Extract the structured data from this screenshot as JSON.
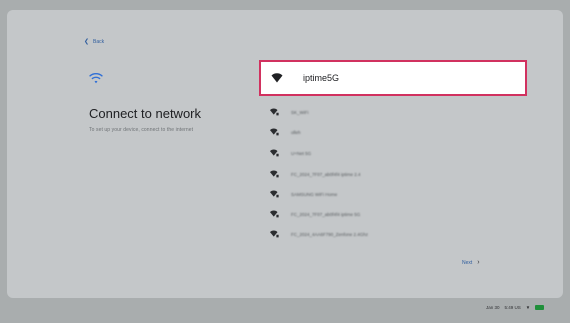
{
  "back": {
    "label": "Back",
    "icon": "arrow-left-icon"
  },
  "hero": {
    "icon": "wifi-icon",
    "title": "Connect to network",
    "subtitle": "To set up your device, connect to the internet"
  },
  "networks": {
    "selected": {
      "name": "iptime5G",
      "icon": "wifi-icon"
    },
    "items": [
      {
        "name": "SK_WiFi"
      },
      {
        "name": "olleh"
      },
      {
        "name": "U+Net 5G"
      },
      {
        "name": "FC_2024_7F07_ab0f4f4 iptime 2.4"
      },
      {
        "name": "SAMSUNG WiFi Home"
      },
      {
        "name": "FC_2024_7F07_ab0f4f4 iptime 5G"
      },
      {
        "name": "FC_2024_4AA6F790_Zenfone 2.4Ghz"
      }
    ]
  },
  "footer": {
    "next_label": "Next",
    "next_icon": "chevron-right-icon"
  },
  "status_bar": {
    "date": "Jan 30",
    "time": "5:49 US",
    "battery": "battery-icon"
  },
  "colors": {
    "highlight": "#d1315f",
    "link": "#2f5d9e",
    "battery": "#1f8f3a"
  }
}
